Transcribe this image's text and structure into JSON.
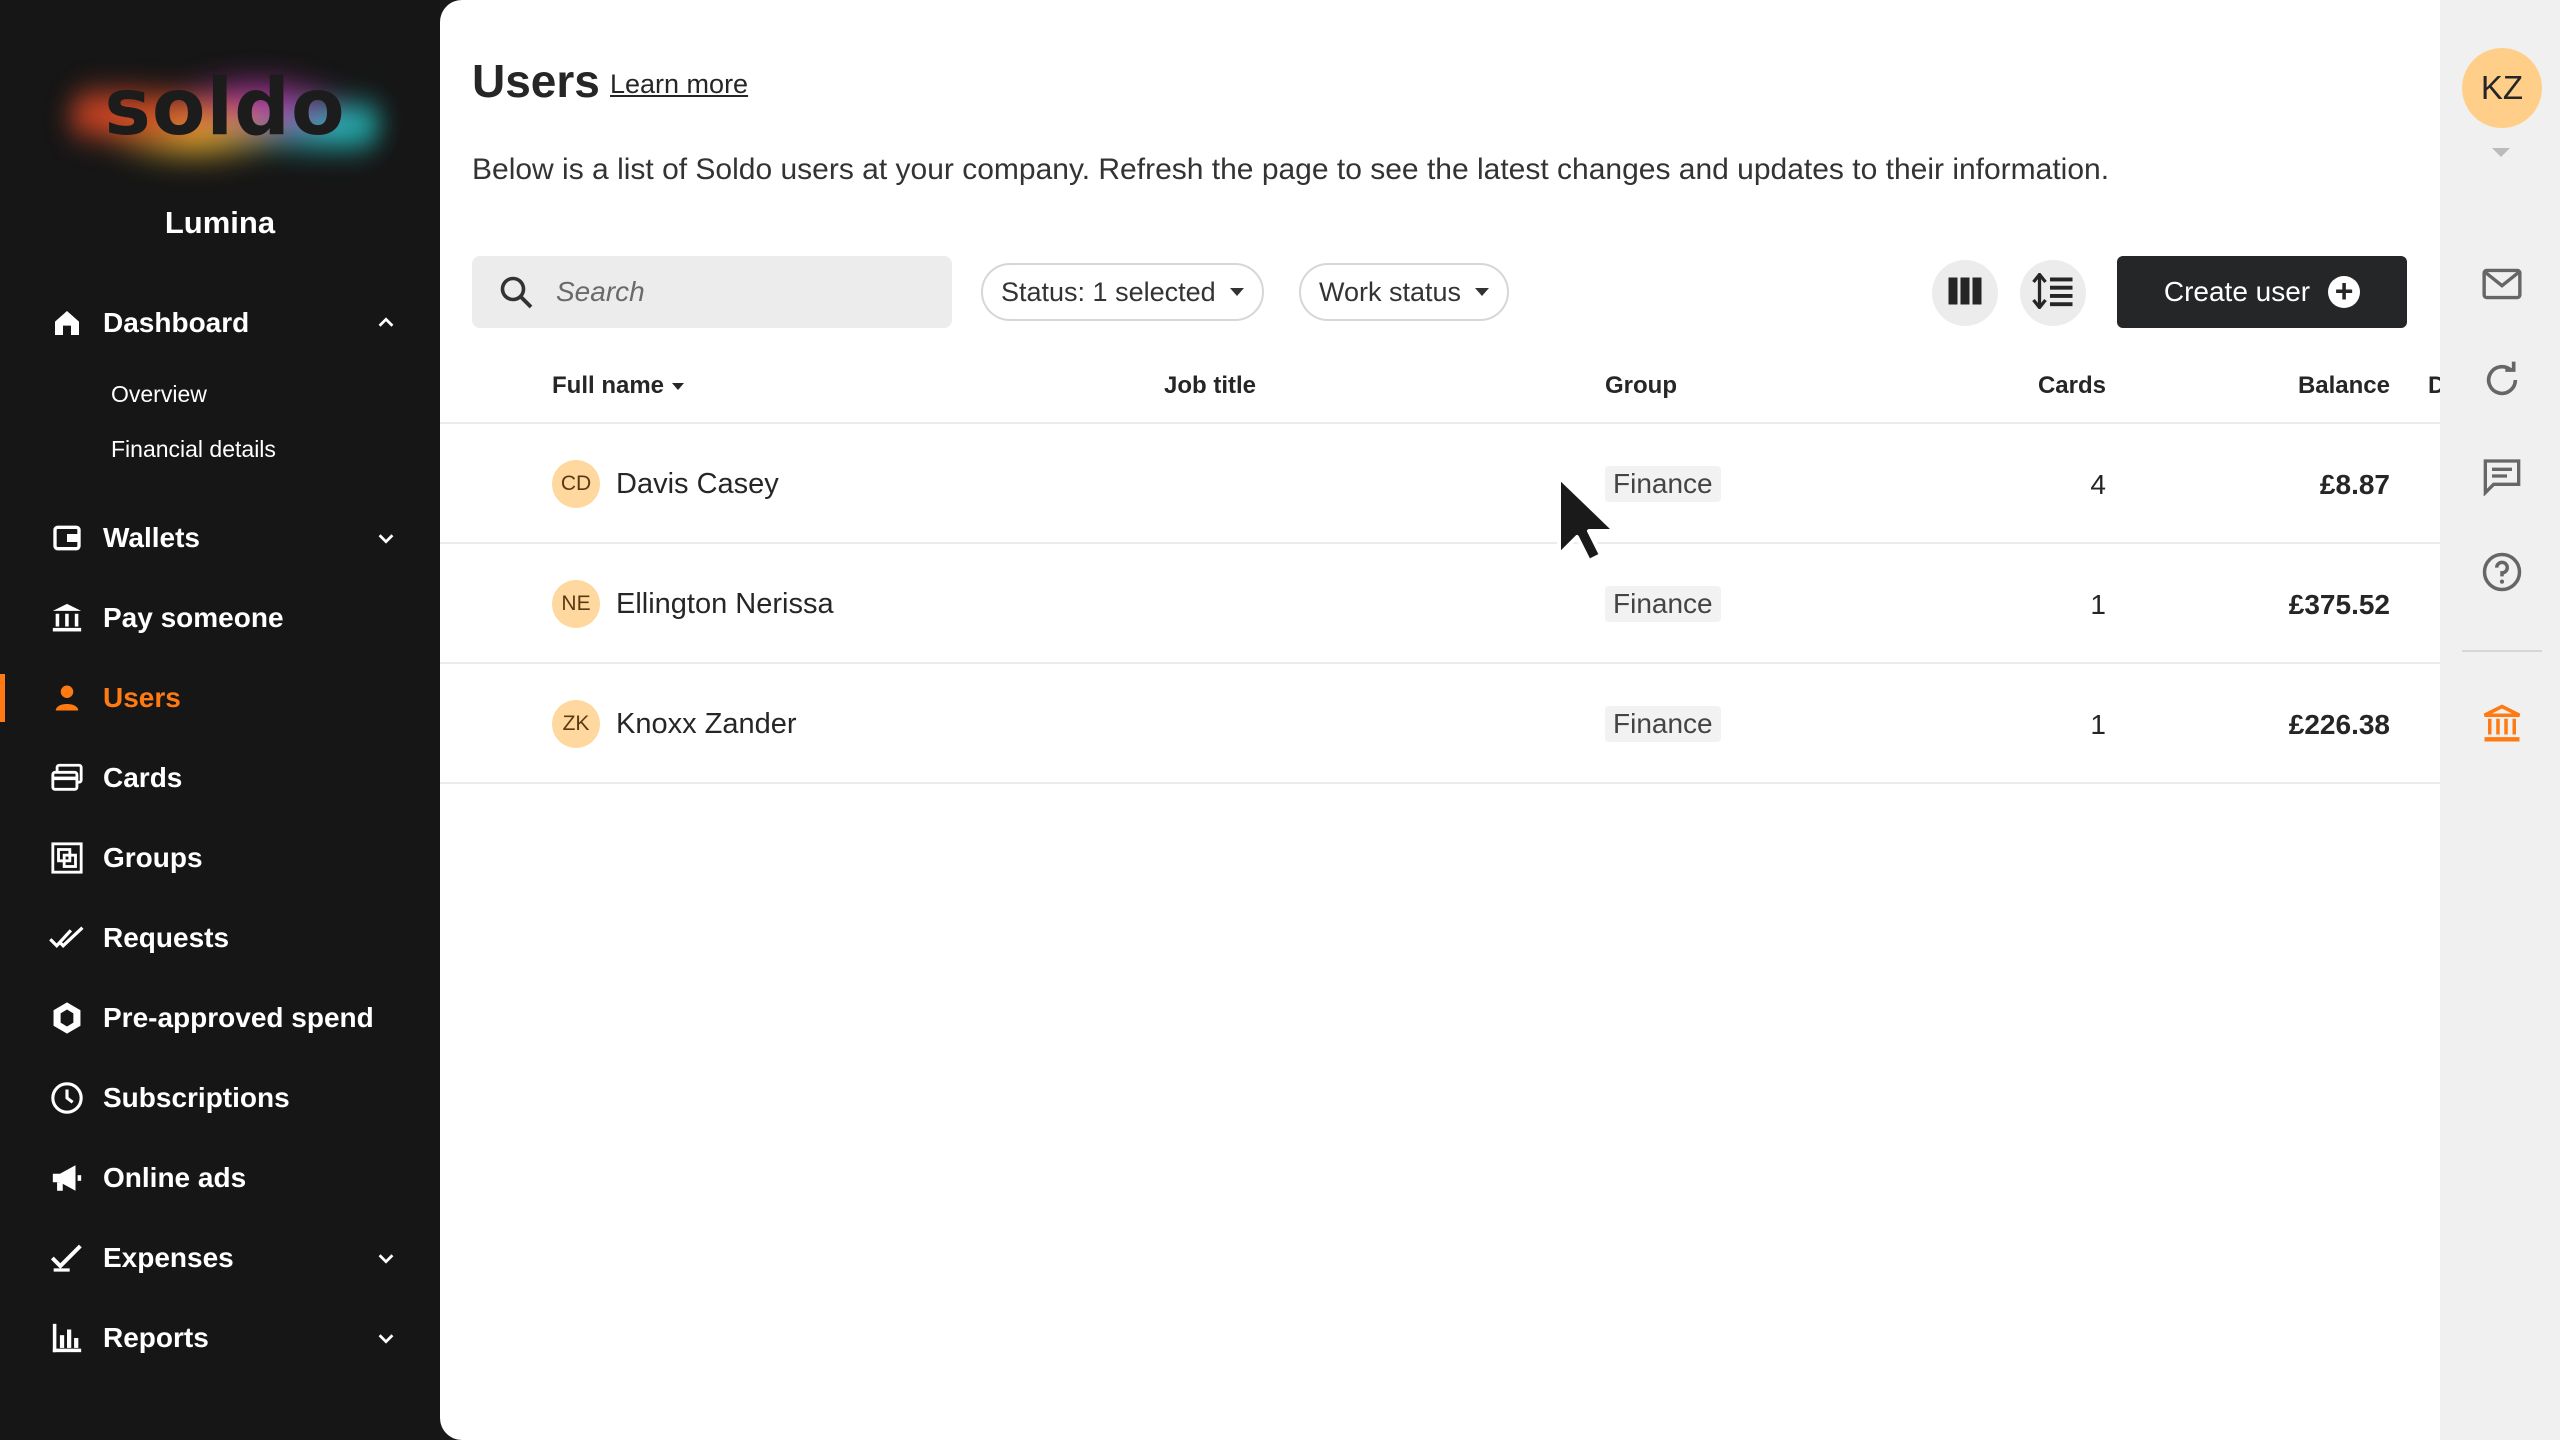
{
  "brand": {
    "logo_text": "soldo",
    "company": "Lumina",
    "accent": "#ff7a12"
  },
  "sidebar": {
    "dashboard": {
      "label": "Dashboard",
      "sub": [
        "Overview",
        "Financial details"
      ]
    },
    "items": [
      {
        "label": "Wallets",
        "icon": "wallet-icon",
        "chevron": true
      },
      {
        "label": "Pay someone",
        "icon": "bank-transfer-icon"
      },
      {
        "label": "Users",
        "icon": "user-icon",
        "active": true
      },
      {
        "label": "Cards",
        "icon": "cards-icon"
      },
      {
        "label": "Groups",
        "icon": "groups-icon"
      },
      {
        "label": "Requests",
        "icon": "double-check-icon"
      },
      {
        "label": "Pre-approved spend",
        "icon": "hexagon-icon"
      },
      {
        "label": "Subscriptions",
        "icon": "clock-icon"
      },
      {
        "label": "Online ads",
        "icon": "megaphone-icon"
      },
      {
        "label": "Expenses",
        "icon": "check-icon",
        "chevron": true
      },
      {
        "label": "Reports",
        "icon": "bar-chart-icon",
        "chevron": true
      }
    ]
  },
  "main": {
    "title": "Users",
    "learn_more": "Learn more",
    "description": "Below is a list of Soldo users at your company. Refresh the page to see the latest changes and updates to their information.",
    "search_placeholder": "Search",
    "filters": {
      "status": "Status: 1 selected",
      "work_status": "Work status"
    },
    "create_user": "Create user",
    "columns": {
      "full_name": "Full name",
      "job_title": "Job title",
      "group": "Group",
      "cards": "Cards",
      "balance": "Balance",
      "overflow": "D"
    },
    "rows": [
      {
        "initials": "CD",
        "name": "Davis Casey",
        "job_title": "",
        "group": "Finance",
        "cards": "4",
        "balance": "£8.87"
      },
      {
        "initials": "NE",
        "name": "Ellington Nerissa",
        "job_title": "",
        "group": "Finance",
        "cards": "1",
        "balance": "£375.52"
      },
      {
        "initials": "ZK",
        "name": "Knoxx Zander",
        "job_title": "",
        "group": "Finance",
        "cards": "1",
        "balance": "£226.38"
      }
    ]
  },
  "rail": {
    "avatar": "KZ",
    "icons": [
      "mail-icon",
      "refresh-icon",
      "chat-icon",
      "help-icon",
      "bank-icon"
    ]
  }
}
